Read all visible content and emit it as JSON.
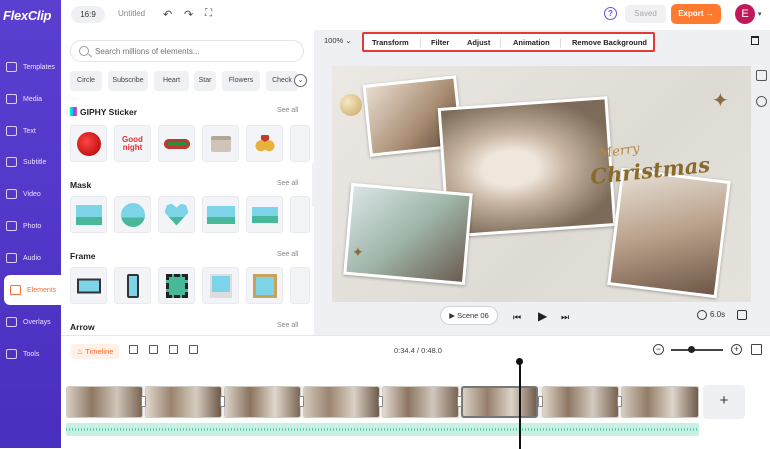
{
  "app": {
    "logo": "FlexClip"
  },
  "sidebar": {
    "items": [
      {
        "label": "Templates"
      },
      {
        "label": "Media"
      },
      {
        "label": "Text"
      },
      {
        "label": "Subtitle"
      },
      {
        "label": "Video"
      },
      {
        "label": "Photo"
      },
      {
        "label": "Audio"
      },
      {
        "label": "Elements"
      },
      {
        "label": "Overlays"
      },
      {
        "label": "Tools"
      }
    ],
    "active": "Elements"
  },
  "topbar": {
    "ratio": "16:9",
    "title": "Untitled",
    "saved_label": "Saved",
    "export_label": "Export →",
    "avatar_initial": "E"
  },
  "panel": {
    "search_placeholder": "Search millions of elements...",
    "chips": [
      "Circle",
      "Subscribe",
      "Heart",
      "Star",
      "Flowers",
      "Check"
    ],
    "sections": [
      {
        "title": "GIPHY Sticker",
        "see_all": "See all"
      },
      {
        "title": "Mask",
        "see_all": "See all"
      },
      {
        "title": "Frame",
        "see_all": "See all"
      },
      {
        "title": "Arrow",
        "see_all": "See all"
      }
    ],
    "sticker_text": "Good night"
  },
  "editor": {
    "zoom": "100%",
    "tools": [
      "Transform",
      "Filter",
      "Adjust",
      "Animation",
      "Remove Background"
    ],
    "stage_text_1": "Merry",
    "stage_text_2": "Christmas",
    "scene_label": "Scene 06",
    "duration": "6.0s"
  },
  "timeline": {
    "label": "Timeline",
    "time": "0:34.4 / 0:48.0",
    "add_label": "+"
  },
  "colors": {
    "accent": "#ff7a2e",
    "brand": "#5a3fd1",
    "highlight": "#e53935"
  }
}
